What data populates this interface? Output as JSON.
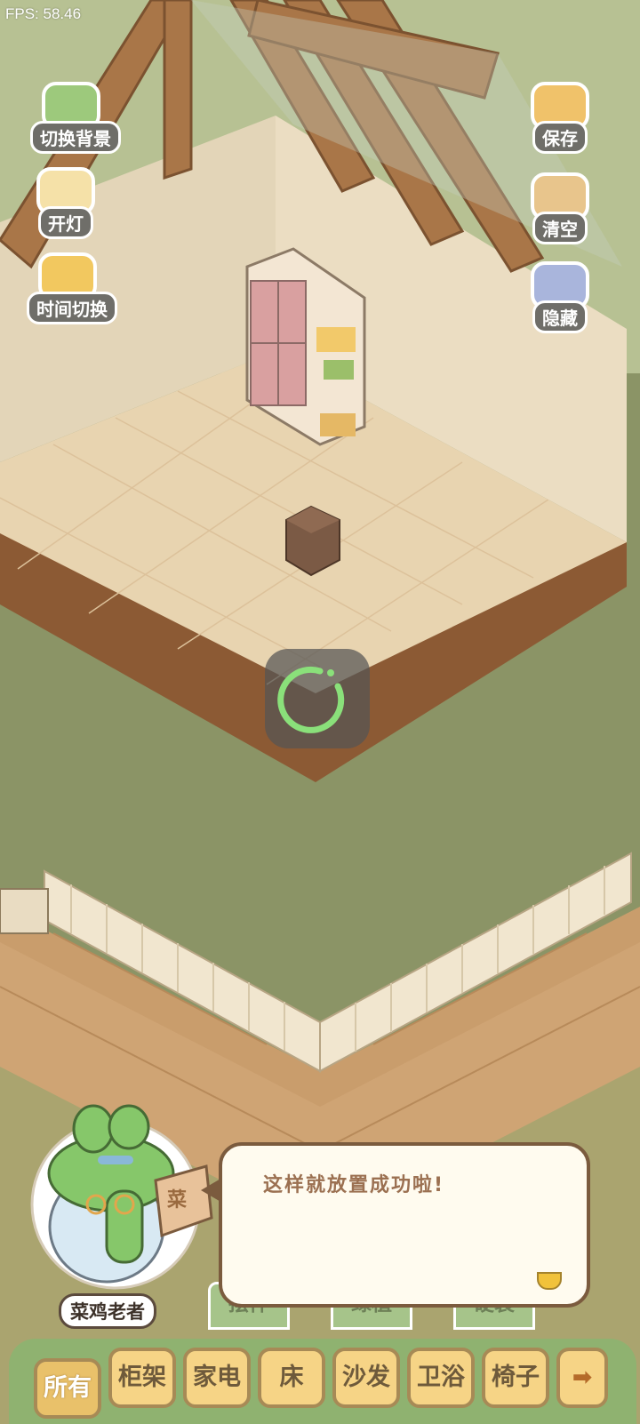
{
  "hud": {
    "fps": "FPS: 58.46"
  },
  "left_buttons": [
    {
      "label": "切换背景",
      "icon": "book-icon"
    },
    {
      "label": "开灯",
      "icon": "lamp-icon"
    },
    {
      "label": "时间切换",
      "icon": "sun-moon-icon"
    }
  ],
  "right_buttons": [
    {
      "label": "保存",
      "icon": "duck-save-icon"
    },
    {
      "label": "清空",
      "icon": "box-clear-icon"
    },
    {
      "label": "隐藏",
      "icon": "hide-frame-icon"
    }
  ],
  "dialog": {
    "speaker": "菜鸡老者",
    "text": "这样就放置成功啦!",
    "book_glyph": "菜"
  },
  "category_tabs_background": [
    "摆件",
    "绿植",
    "硬装"
  ],
  "categories": [
    "所有",
    "柜架",
    "家电",
    "床",
    "沙发",
    "卫浴",
    "椅子"
  ],
  "selected_category": "所有",
  "next_arrow": "➡",
  "colors": {
    "ground": "#8b9466",
    "floor": "#e8d4b0",
    "wall": "#e6d8bc",
    "wood": "#9a6a3f",
    "accent_green": "#7fd07a"
  }
}
